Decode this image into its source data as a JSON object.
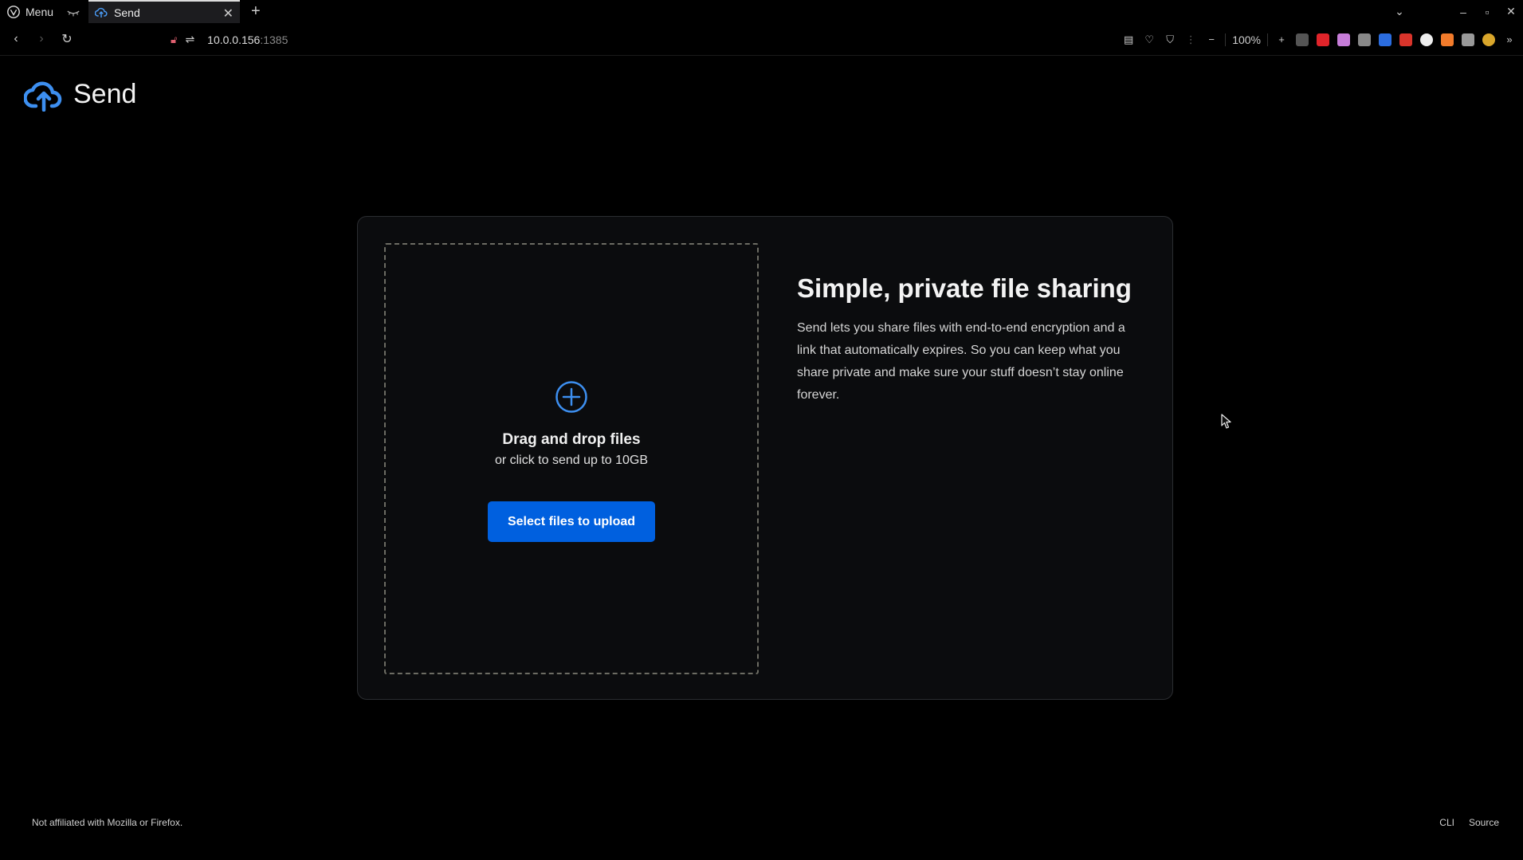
{
  "browser": {
    "menu_label": "Menu",
    "tab_title": "Send",
    "url_host": "10.0.0.156",
    "url_port": ":1385",
    "zoom": "100%"
  },
  "page": {
    "brand": "Send",
    "dropzone": {
      "title": "Drag and drop files",
      "subtitle": "or click to send up to 10GB",
      "button_label": "Select files to upload"
    },
    "intro": {
      "heading": "Simple, private file sharing",
      "body": "Send lets you share files with end-to-end encryption and a link that automatically expires. So you can keep what you share private and make sure your stuff doesn’t stay online forever."
    },
    "footer": {
      "disclaimer": "Not affiliated with Mozilla or Firefox.",
      "links": [
        "CLI",
        "Source"
      ]
    }
  },
  "colors": {
    "accent": "#0060df",
    "logo_blue": "#3d8ff0",
    "background": "#000000",
    "card": "#0b0c0e"
  }
}
